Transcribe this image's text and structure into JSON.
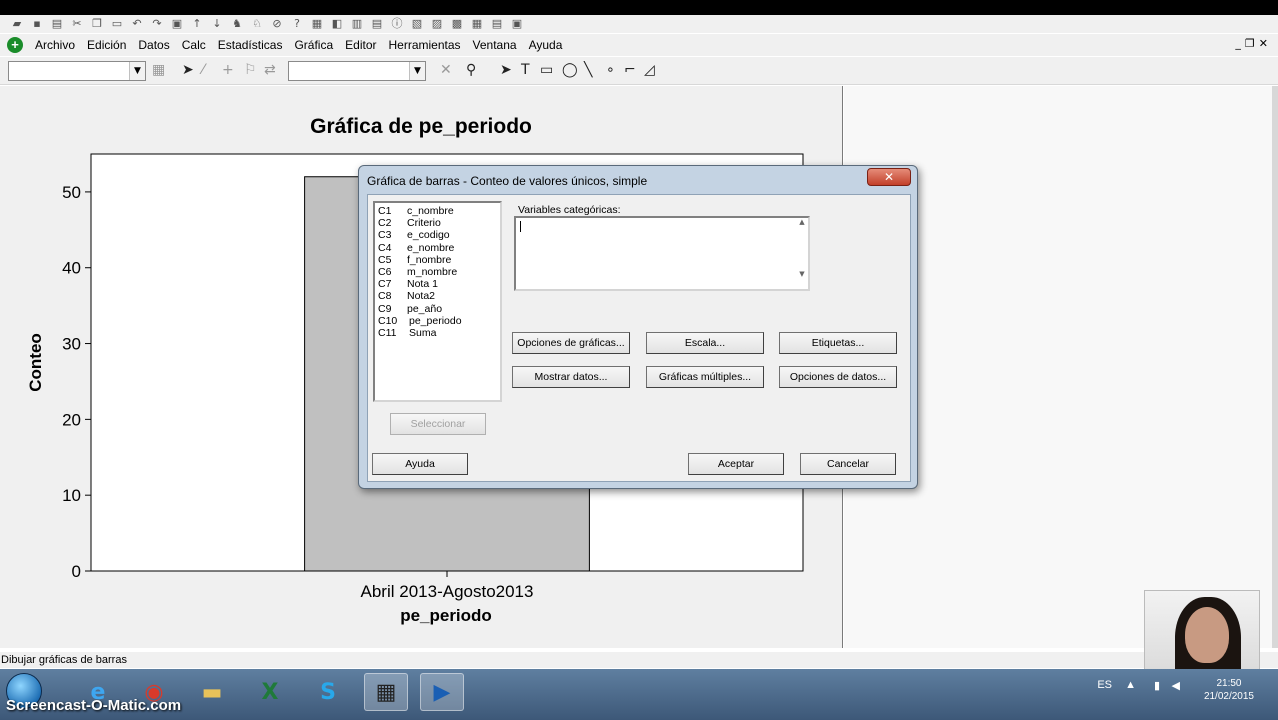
{
  "menu": {
    "items": [
      "Archivo",
      "Edición",
      "Datos",
      "Calc",
      "Estadísticas",
      "Gráfica",
      "Editor",
      "Herramientas",
      "Ventana",
      "Ayuda"
    ]
  },
  "chart_data": {
    "type": "bar",
    "title": "Gráfica de pe_periodo",
    "categories": [
      "Abril 2013-Agosto2013"
    ],
    "values": [
      52
    ],
    "xlabel": "pe_periodo",
    "ylabel": "Conteo",
    "yticks": [
      0,
      10,
      20,
      30,
      40,
      50
    ],
    "ylim": [
      0,
      55
    ],
    "grid": false,
    "bar_color": "#c0c0c0",
    "plot_bg": "#ffffff",
    "frame_bg": "#f0f0f0"
  },
  "dialog": {
    "title": "Gráfica de barras - Conteo de valores únicos, simple",
    "close": "✕",
    "variables": [
      {
        "col": "C1",
        "name": "c_nombre"
      },
      {
        "col": "C2",
        "name": "Criterio"
      },
      {
        "col": "C3",
        "name": "e_codigo"
      },
      {
        "col": "C4",
        "name": "e_nombre"
      },
      {
        "col": "C5",
        "name": "f_nombre"
      },
      {
        "col": "C6",
        "name": "m_nombre"
      },
      {
        "col": "C7",
        "name": "Nota 1"
      },
      {
        "col": "C8",
        "name": "Nota2"
      },
      {
        "col": "C9",
        "name": "pe_año"
      },
      {
        "col": "C10",
        "name": "pe_periodo"
      },
      {
        "col": "C11",
        "name": "Suma"
      }
    ],
    "categorical_label": "Variables categóricas:",
    "buttons": {
      "graph_options": "Opciones de gráficas...",
      "scale": "Escala...",
      "labels": "Etiquetas...",
      "show_data": "Mostrar datos...",
      "multiple_graphs": "Gráficas múltiples...",
      "data_options": "Opciones de datos...",
      "select": "Seleccionar",
      "help": "Ayuda",
      "ok": "Aceptar",
      "cancel": "Cancelar"
    }
  },
  "status": {
    "text": "Dibujar gráficas de barras"
  },
  "taskbar": {
    "language": "ES",
    "time": "21:50",
    "date": "21/02/2015",
    "apps": [
      "internet-explorer",
      "chrome",
      "file-explorer",
      "excel",
      "skype",
      "screen-recorder",
      "minitab"
    ]
  },
  "watermark": "Screencast-O-Matic.com"
}
